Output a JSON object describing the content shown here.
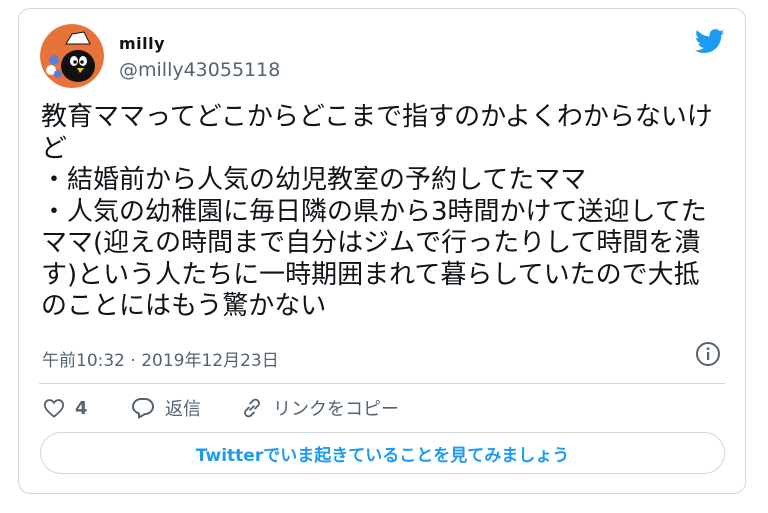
{
  "author": {
    "name": "milly",
    "handle": "@milly43055118"
  },
  "tweet": {
    "text": "教育ママってどこからどこまで指すのかよくわからないけど\n・結婚前から人気の幼児教室の予約してたママ\n・人気の幼稚園に毎日隣の県から3時間かけて送迎してたママ(迎えの時間まで自分はジムで行ったりして時間を潰す)という人たちに一時期囲まれて暮らしていたので大抵のことにはもう驚かない",
    "timestamp": "午前10:32 · 2019年12月23日"
  },
  "actions": {
    "like_count": "4",
    "reply_label": "返信",
    "share_label": "リンクをコピー"
  },
  "cta": {
    "label": "Twitterでいま起きていることを見てみましょう"
  },
  "colors": {
    "accent": "#1d9bf0",
    "secondary_text": "#536471",
    "border": "#cfd9de"
  },
  "icons": [
    "twitter-bird-icon",
    "info-icon",
    "heart-icon",
    "reply-bubble-icon",
    "link-icon"
  ]
}
